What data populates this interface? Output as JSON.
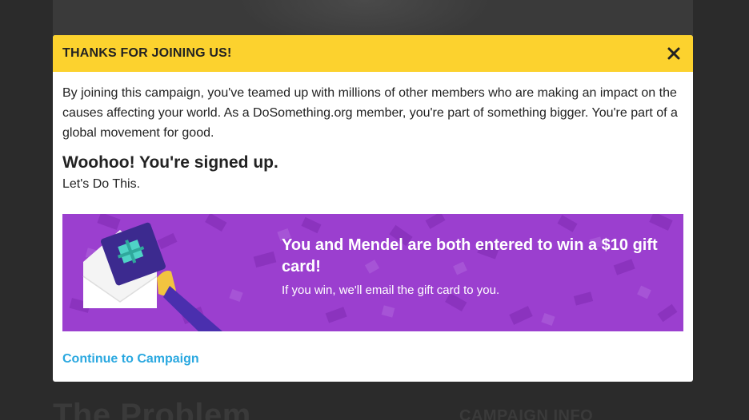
{
  "background": {
    "heading": "The Problem",
    "side_heading": "CAMPAIGN INFO"
  },
  "modal": {
    "title": "THANKS FOR JOINING US!",
    "close_icon": "close-icon",
    "intro": "By joining this campaign, you've teamed up with millions of other members who are making an impact on the causes affecting your world. As a DoSomething.org member, you're part of something bigger. You're part of a global movement for good.",
    "signed_heading": "Woohoo! You're signed up.",
    "lets_do": "Let's Do This.",
    "prize": {
      "headline": "You and Mendel are both entered to win a $10 gift card!",
      "sub": "If you win, we'll email the gift card to you."
    },
    "continue_label": "Continue to Campaign"
  },
  "colors": {
    "header_yellow": "#fcd22e",
    "banner_purple": "#9b3fcf",
    "link_blue": "#2aa8e0"
  }
}
